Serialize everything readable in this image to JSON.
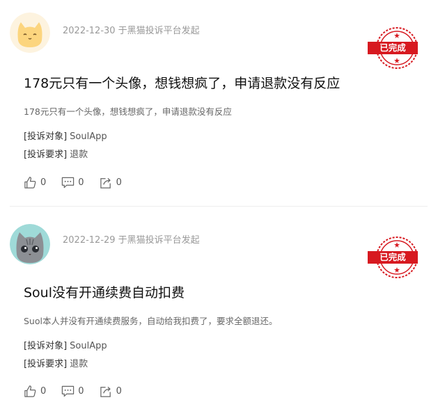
{
  "complaints": [
    {
      "date_source": "2022-12-30 于黑猫投诉平台发起",
      "status": "已完成",
      "title": "178元只有一个头像，想钱想疯了，申请退款没有反应",
      "description": "178元只有一个头像，想钱想疯了，申请退款没有反应",
      "target_label": "[投诉对象]",
      "target_value": "SoulApp",
      "request_label": "[投诉要求]",
      "request_value": "退款",
      "likes": "0",
      "comments": "0",
      "shares": "0",
      "avatar": "cat-avatar-yellow"
    },
    {
      "date_source": "2022-12-29 于黑猫投诉平台发起",
      "status": "已完成",
      "title": "Soul没有开通续费自动扣费",
      "description": "Suol本人并没有开通续费服务，自动给我扣费了，要求全额退还。",
      "target_label": "[投诉对象]",
      "target_value": "SoulApp",
      "request_label": "[投诉要求]",
      "request_value": "退款",
      "likes": "0",
      "comments": "0",
      "shares": "0",
      "avatar": "cat-avatar-gray"
    }
  ],
  "colors": {
    "stamp_red": "#d71920",
    "meta_gray": "#999999",
    "divider": "#eeeeee"
  },
  "icons": [
    "thumbs-up-icon",
    "comment-icon",
    "share-icon"
  ]
}
